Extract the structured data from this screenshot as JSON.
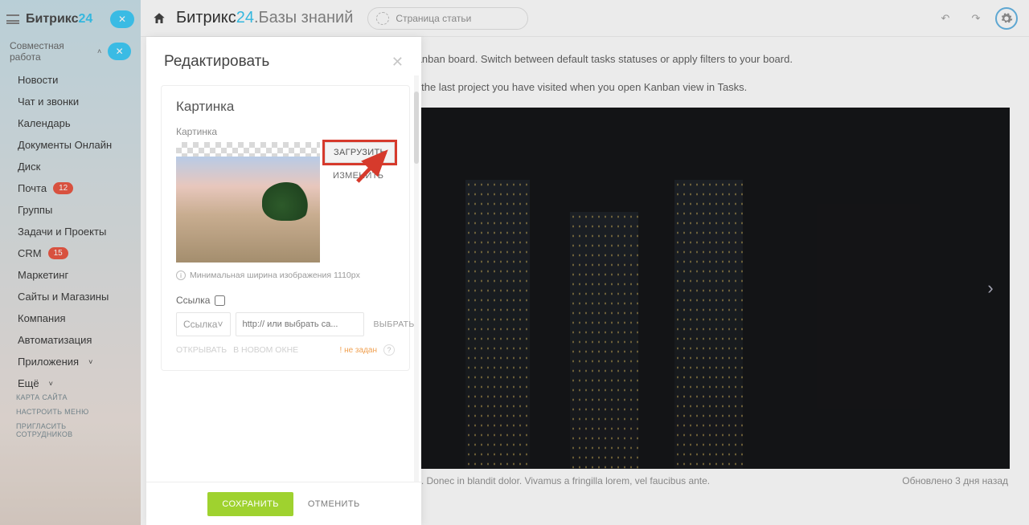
{
  "logo": {
    "part1": "Битрикс",
    "part2": "24"
  },
  "section": {
    "title": "Совместная работа"
  },
  "menu": {
    "items": [
      {
        "label": "Новости"
      },
      {
        "label": "Чат и звонки"
      },
      {
        "label": "Календарь"
      },
      {
        "label": "Документы Онлайн"
      },
      {
        "label": "Диск"
      },
      {
        "label": "Почта",
        "badge": "12"
      },
      {
        "label": "Группы"
      },
      {
        "label": "Задачи и Проекты"
      },
      {
        "label": "CRM",
        "badge": "15"
      },
      {
        "label": "Маркетинг"
      },
      {
        "label": "Сайты и Магазины"
      },
      {
        "label": "Компания"
      },
      {
        "label": "Автоматизация"
      },
      {
        "label": "Приложения"
      },
      {
        "label": "Ещё"
      }
    ]
  },
  "sidebar_links": {
    "map": "КАРТА САЙТА",
    "configure": "НАСТРОИТЬ МЕНЮ",
    "invite": "ПРИГЛАСИТЬ СОТРУДНИКОВ"
  },
  "topbar": {
    "title1": "Битрикс",
    "title2": "24",
    "title3": ".Базы знаний",
    "pagetype": "Страница статьи"
  },
  "article": {
    "p1": "…ew search & filter options are available above each Kanban board. Switch between default tasks statuses or apply filters to your board.",
    "p2": "…mart Kanban - the system will automatically show you the last project you have visited when you open Kanban view in Tasks.",
    "footer_text": "Sed feugiat porttitor nunc, non dignissim ipsum vestibulum in. Donec in blandit dolor. Vivamus a fringilla lorem, vel faucibus ante.",
    "updated": "Обновлено 3 дня назад"
  },
  "modal": {
    "title": "Редактировать",
    "card_title": "Картинка",
    "field_label": "Картинка",
    "upload": "ЗАГРУЗИТЬ",
    "edit": "ИЗМЕНИТЬ",
    "hint": "Минимальная ширина изображения 1110px",
    "link_label": "Ссылка",
    "select_value": "Ссылка",
    "url_placeholder": "http:// или выбрать са...",
    "choose": "ВЫБРАТЬ",
    "open_label": "ОТКРЫВАТЬ",
    "open_mode": "В НОВОМ ОКНЕ",
    "warn": "! не задан",
    "save": "СОХРАНИТЬ",
    "cancel": "ОТМЕНИТЬ"
  }
}
